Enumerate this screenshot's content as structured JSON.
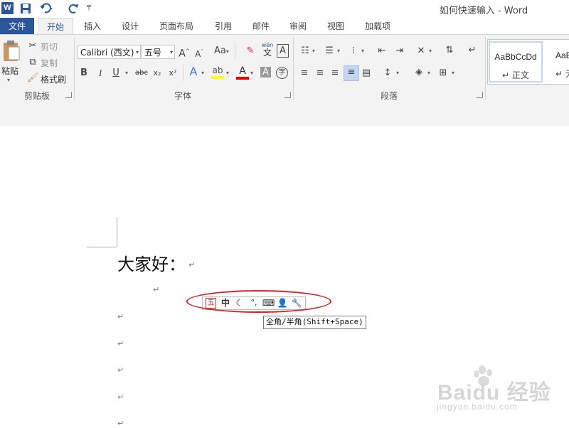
{
  "window": {
    "title": "如何快速输入 - Word"
  },
  "qat": {
    "word_icon": "W",
    "save_icon": "save-icon",
    "undo_icon": "undo-icon",
    "redo_icon": "redo-icon",
    "customize_icon": "customize-icon"
  },
  "tabs": [
    "文件",
    "开始",
    "插入",
    "设计",
    "页面布局",
    "引用",
    "邮件",
    "审阅",
    "视图",
    "加载项"
  ],
  "active_tab": "开始",
  "clipboard": {
    "paste": "粘贴",
    "cut": "剪切",
    "copy": "复制",
    "format_painter": "格式刷",
    "label": "剪贴板"
  },
  "font": {
    "family": "Calibri (西文)",
    "size": "五号",
    "label": "字体",
    "aa": "Aa",
    "bold": "B",
    "italic": "I",
    "underline": "U",
    "strike": "abc",
    "sub": "x₂",
    "sup": "x²",
    "wen": "wén",
    "wen_char": "文",
    "a_frame": "A",
    "char_circle": "字"
  },
  "paragraph": {
    "label": "段落"
  },
  "styles": [
    {
      "sample": "AaBbCcDd",
      "name": "正文"
    },
    {
      "sample": "AaBbC",
      "name": "无间"
    }
  ],
  "document": {
    "greeting": "大家好：",
    "para_mark": "↵"
  },
  "ime": {
    "wu": "五",
    "zhong": "中"
  },
  "tooltip": "全角/半角(Shift+Space)",
  "watermark": {
    "text": "Baidu 经验",
    "url": "jingyan.baidu.com"
  },
  "colors": {
    "accent": "#2b579a",
    "ribbon_bg": "#f3f3f3",
    "highlight": "#c5d7ef",
    "circle": "#d8262c",
    "font_color_bar": "#e00000",
    "highlight_bar": "#ffff00"
  }
}
